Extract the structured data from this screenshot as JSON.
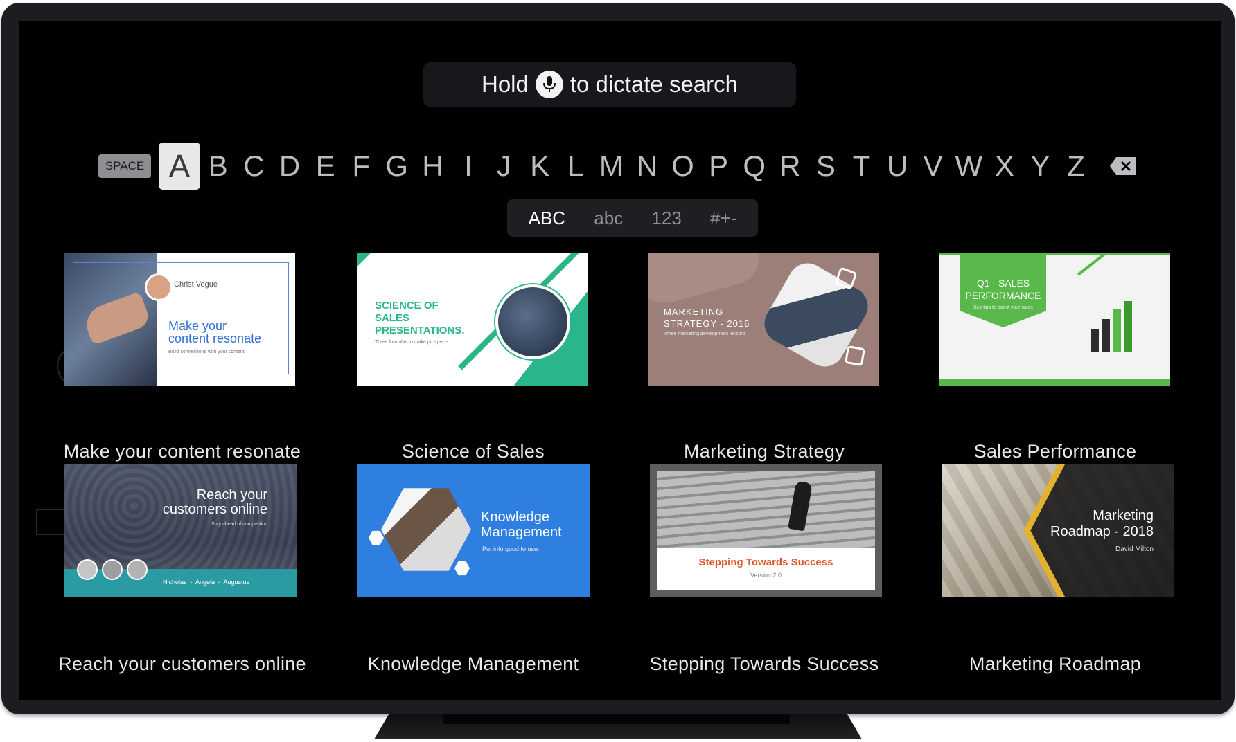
{
  "dictation": {
    "prefix": "Hold",
    "suffix": "to dictate search",
    "icon": "microphone-icon"
  },
  "keyboard": {
    "space_label": "SPACE",
    "letters": [
      "A",
      "B",
      "C",
      "D",
      "E",
      "F",
      "G",
      "H",
      "I",
      "J",
      "K",
      "L",
      "M",
      "N",
      "O",
      "P",
      "Q",
      "R",
      "S",
      "T",
      "U",
      "V",
      "W",
      "X",
      "Y",
      "Z"
    ],
    "focused_letter": "A",
    "delete_icon": "backspace-icon"
  },
  "modes": [
    "ABC",
    "abc",
    "123",
    "#+-"
  ],
  "active_mode": "ABC",
  "results": [
    {
      "label": "Make your content resonate",
      "thumb": {
        "author": "Christ Vogue",
        "title_line1": "Make your",
        "title_line2": "content resonate",
        "subtitle": "Build connections with your content",
        "accent": "#2f6fd6"
      }
    },
    {
      "label": "Science of Sales",
      "thumb": {
        "title_line1": "SCIENCE OF",
        "title_line2": "SALES",
        "title_line3": "PRESENTATIONS.",
        "subtitle": "Three formulas to make prospects",
        "accent": "#2bb58a"
      }
    },
    {
      "label": "Marketing Strategy",
      "thumb": {
        "title_line1": "MARKETING",
        "title_line2": "STRATEGY - 2016",
        "subtitle": "Three marketing development lessons",
        "accent": "#9b7f78"
      }
    },
    {
      "label": "Sales Performance",
      "thumb": {
        "title_line1": "Q1 - SALES",
        "title_line2": "PERFORMANCE",
        "subtitle": "Key tips to boost your sales",
        "accent": "#59b84a"
      }
    },
    {
      "label": "Reach your customers online",
      "thumb": {
        "title_line1": "Reach your",
        "title_line2": "customers online",
        "subtitle": "Stay ahead of competition",
        "names": "Nicholas  -  Angela  -  Augustus",
        "accent": "#2a9ba3"
      }
    },
    {
      "label": "Knowledge Management",
      "thumb": {
        "title_line1": "Knowledge",
        "title_line2": "Management",
        "subtitle": "Put info good to use.",
        "accent": "#2f7fe0"
      }
    },
    {
      "label": "Stepping Towards Success",
      "thumb": {
        "title": "Stepping Towards Success",
        "subtitle": "Version 2.0",
        "accent": "#e0582a"
      }
    },
    {
      "label": "Marketing Roadmap",
      "thumb": {
        "title_line1": "Marketing",
        "title_line2": "Roadmap - 2018",
        "subtitle": "David Milton",
        "accent": "#e2b22e"
      }
    }
  ]
}
